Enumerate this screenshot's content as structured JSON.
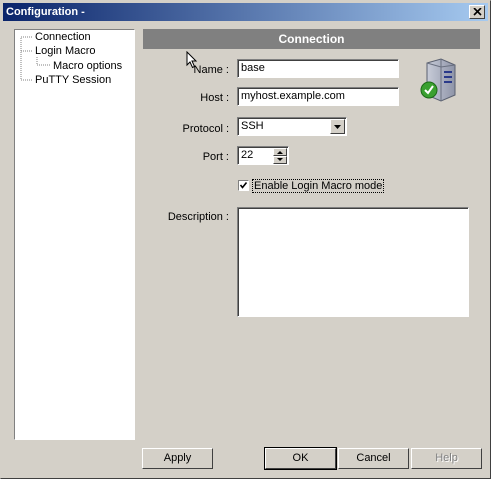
{
  "window": {
    "title": "Configuration -"
  },
  "tree": {
    "items": [
      {
        "label": "Connection"
      },
      {
        "label": "Login Macro"
      },
      {
        "label": "Macro options"
      },
      {
        "label": "PuTTY Session"
      }
    ]
  },
  "panel": {
    "title": "Connection"
  },
  "form": {
    "name_label": "Name :",
    "name_value": "base",
    "host_label": "Host :",
    "host_value": "myhost.example.com",
    "protocol_label": "Protocol :",
    "protocol_value": "SSH",
    "port_label": "Port :",
    "port_value": "22",
    "macro_checkbox_label": "Enable Login Macro mode",
    "macro_checkbox_checked": true,
    "description_label": "Description :",
    "description_value": ""
  },
  "buttons": {
    "apply": "Apply",
    "ok": "OK",
    "cancel": "Cancel",
    "help": "Help"
  },
  "icons": {
    "close": "close-icon",
    "server": "server-check-icon",
    "cursor": "mouse-pointer-icon"
  },
  "colors": {
    "titlebar_start": "#0a246a",
    "titlebar_end": "#a6caf0",
    "panel_header": "#808080",
    "face": "#d4d0c8"
  }
}
